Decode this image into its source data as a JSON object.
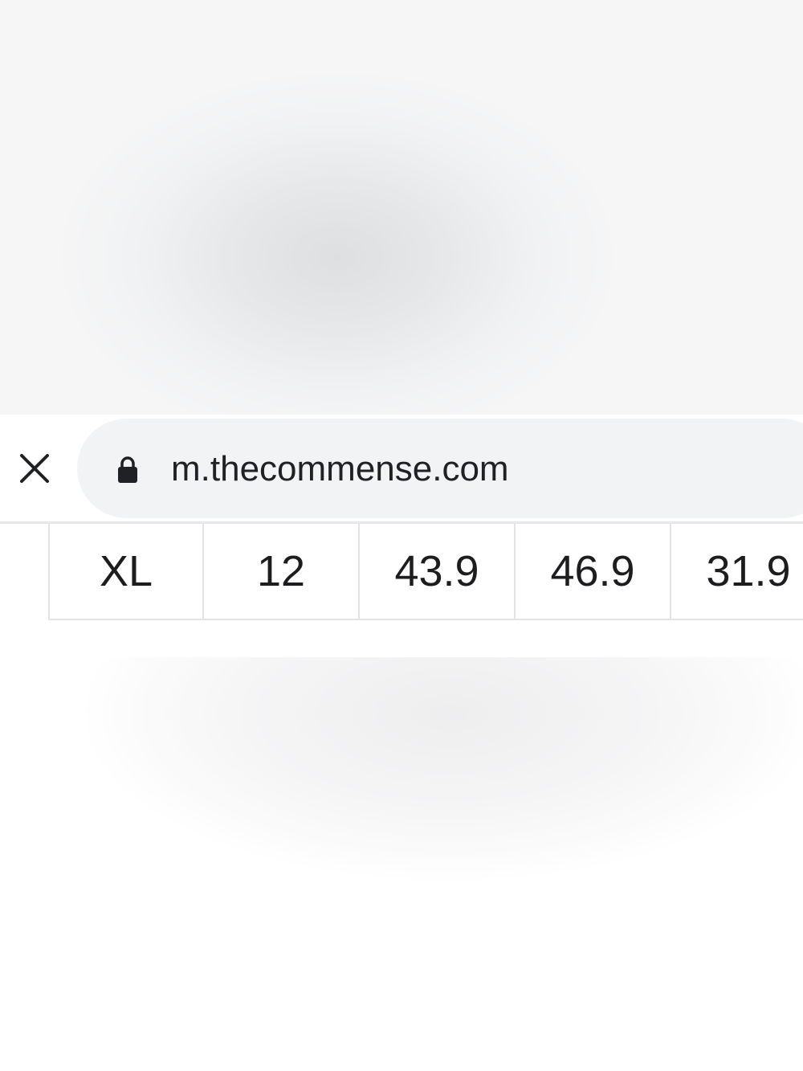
{
  "browser": {
    "url": "m.thecommense.com",
    "close_icon": "close-icon",
    "lock_icon": "lock-icon"
  },
  "size_table": {
    "row": [
      "XL",
      "12",
      "43.9",
      "46.9",
      "31.9"
    ]
  }
}
